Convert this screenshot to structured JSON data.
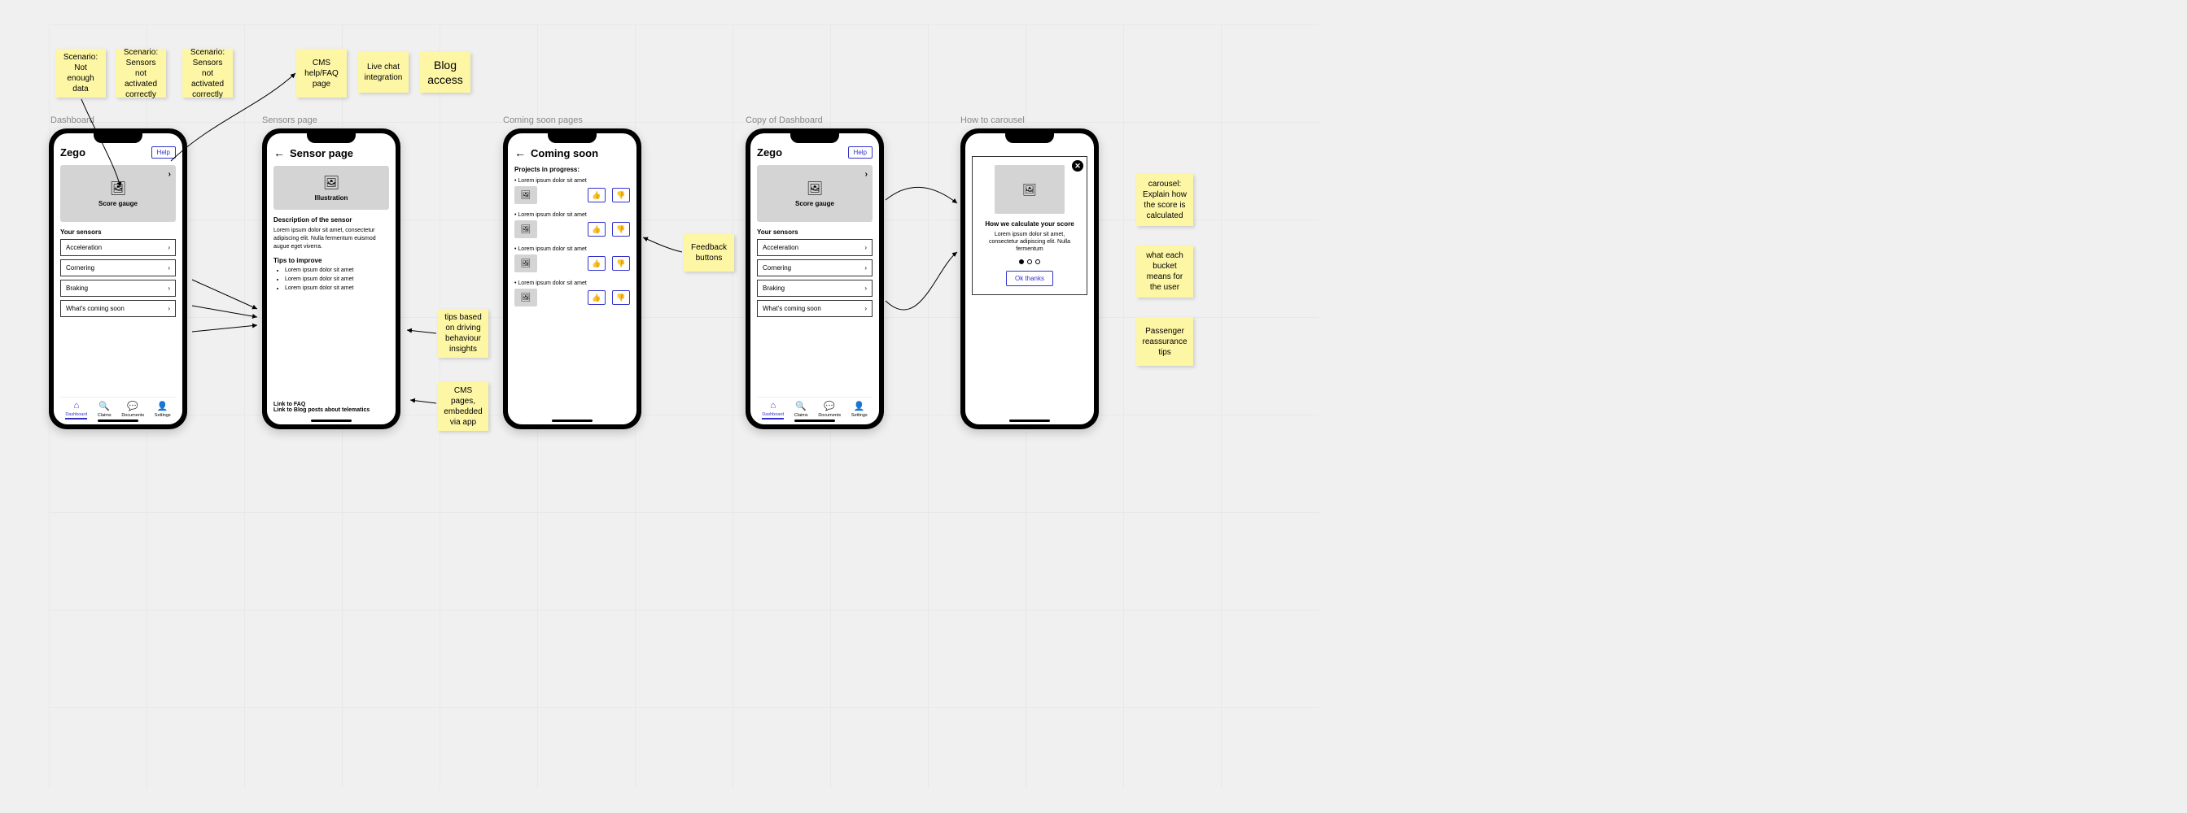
{
  "stickies": {
    "s1": "Scenario: Not enough data",
    "s2": "Scenario: Sensors not activated correctly",
    "s3": "Scenario: Sensors not activated correctly",
    "s4": "CMS help/FAQ page",
    "s5": "Live chat integration",
    "s6": "Blog access",
    "s7": "tips based on driving behaviour insights",
    "s8": "CMS pages, embedded via app",
    "s9": "Feedback buttons",
    "s10": "carousel: Explain how the score is calculated",
    "s11": "what each bucket means for the user",
    "s12": "Passenger reassurance tips"
  },
  "labels": {
    "l1": "Dashboard",
    "l2": "Sensors page",
    "l3": "Coming soon pages",
    "l4": "Copy of Dashboard",
    "l5": "How to carousel"
  },
  "brand": "Zego",
  "help": "Help",
  "gauge_label": "Score gauge",
  "illus_label": "Illustration",
  "dash": {
    "sensors_title": "Your sensors",
    "items": {
      "0": "Acceleration",
      "1": "Cornering",
      "2": "Braking",
      "3": "What's coming soon"
    }
  },
  "nav": {
    "0": "Dashboard",
    "1": "Claims",
    "2": "Documents",
    "3": "Settings"
  },
  "sensor": {
    "title": "Sensor page",
    "desc_title": "Description of the sensor",
    "desc_body": "Lorem ipsum dolor sit amet, consectetur adipiscing elit. Nulla fermentum euismod augue eget viverra.",
    "tips_title": "Tips to improve",
    "tips": {
      "0": "Lorem ipsum dolor sit amet",
      "1": "Lorem ipsum dolor sit amet",
      "2": "Lorem ipsum dolor sit amet"
    },
    "link_faq": "Link to FAQ",
    "link_blog": "Link to Blog posts about telematics"
  },
  "coming": {
    "title": "Coming soon",
    "proj_title": "Projects in progress:",
    "item": "Lorem ipsum dolor sit amet"
  },
  "carousel": {
    "title": "How we calculate your score",
    "body": "Lorem ipsum dolor sit amet, consectetur adipiscing elit. Nulla fermentum",
    "ok": "Ok thanks"
  }
}
